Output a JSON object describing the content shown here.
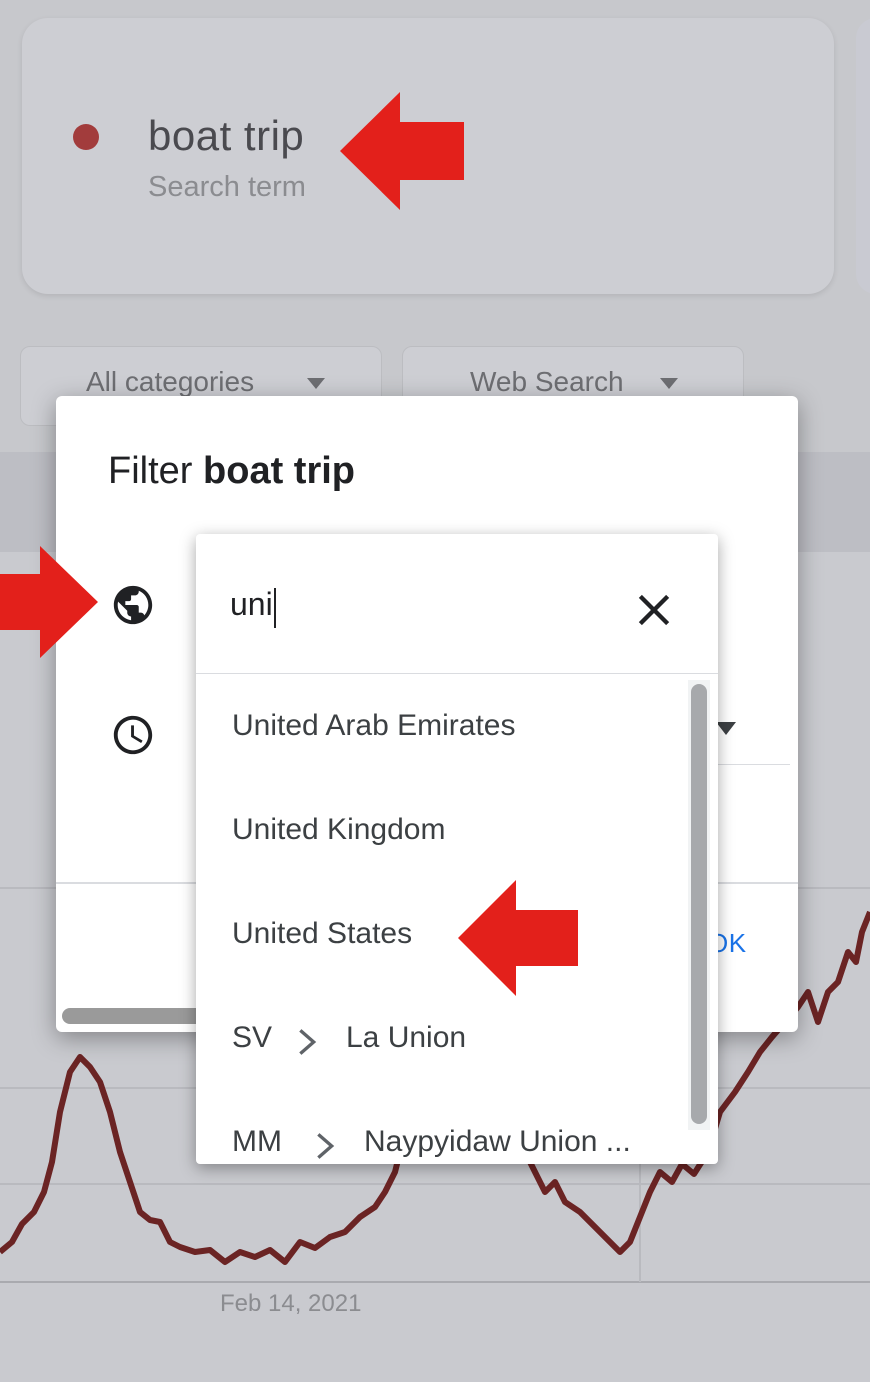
{
  "search_term": {
    "name": "boat trip",
    "type_label": "Search term",
    "color": "#a23c3c"
  },
  "filters": {
    "category": "All categories",
    "search_type": "Web Search"
  },
  "chart": {
    "date_label": "Feb 14, 2021",
    "line_color": "#6b2424"
  },
  "dialog": {
    "title_prefix": "Filter",
    "title_term": "boat trip",
    "ok_label": "OK",
    "location_icon": "globe-icon",
    "time_icon": "clock-icon"
  },
  "location_dropdown": {
    "query": "uni",
    "clear_icon": "close-icon",
    "options": [
      {
        "label": "United Arab Emirates"
      },
      {
        "label": "United Kingdom"
      },
      {
        "label": "United States"
      },
      {
        "code": "SV",
        "region": "La Union"
      },
      {
        "code": "MM",
        "region": "Naypyidaw Union ..."
      }
    ]
  },
  "annotations": {
    "arrow_color": "#e3201b"
  }
}
